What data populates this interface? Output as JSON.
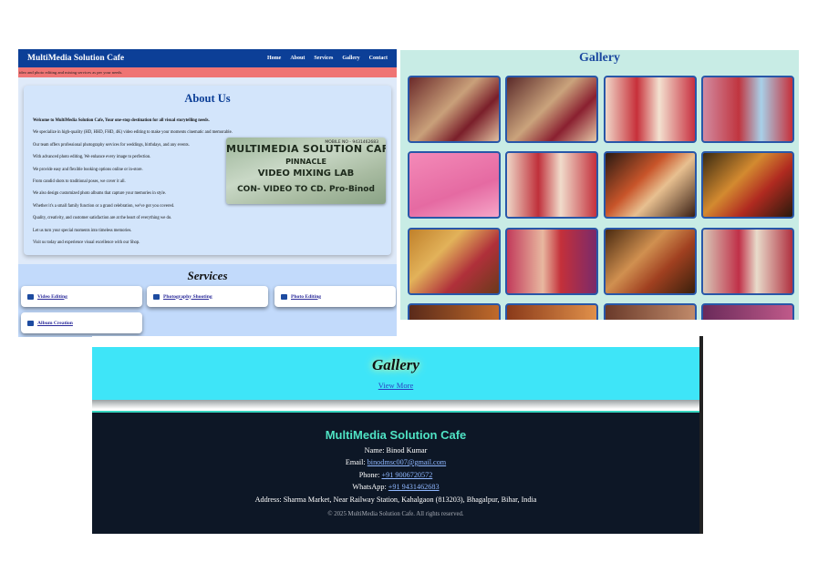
{
  "home": {
    "brand": "MultiMedia Solution Cafe",
    "nav": [
      "Home",
      "About",
      "Services",
      "Gallery",
      "Contact"
    ],
    "marquee": "ideo and photo editing and mixing services as per your needs.",
    "about": {
      "title": "About Us",
      "lines": [
        "Welcome to MultiMedia Solution Cafe, Your one-stop destination for all visual storytelling needs.",
        "We specialize in high-quality (HD, HHD, FHD, 4K) video editing to make your moments cinematic and memorable.",
        "Our team offers professional photography services for weddings, birthdays, and any events.",
        "With advanced photo editing, We enhance every image to perfection.",
        "We provide easy and flexible booking options online or in-store.",
        "From candid shots to traditional poses, we cover it all.",
        "We also design customized photo albums that capture your memories in style.",
        "Whether it's a small family function or a grand celebration, we've got you covered.",
        "Quality, creativity, and customer satisfaction are at the heart of everything we do.",
        "Let us turn your special moments into timeless memories.",
        "Visit us today and experience visual excellence with our Shop."
      ],
      "shop_sign": {
        "line1": "MULTIMEDIA SOLUTION CAFE",
        "line2": "PINNACLE",
        "line3": "VIDEO MIXING LAB",
        "line4": "CON- VIDEO TO CD. Pro-Binod",
        "mobile": "MOBILE NO - 9431462683"
      }
    },
    "services": {
      "title": "Services",
      "items": [
        {
          "label": "Video Editing",
          "icon": "video-camera-icon"
        },
        {
          "label": "Photography Shooting",
          "icon": "camera-icon"
        },
        {
          "label": "Photo Editing",
          "icon": "image-icon"
        },
        {
          "label": "Album Creation",
          "icon": "book-icon"
        }
      ]
    }
  },
  "gallery_page": {
    "title": "Gallery"
  },
  "gallery_section": {
    "title": "Gallery",
    "view_more": "View More"
  },
  "footer": {
    "title": "MultiMedia Solution Cafe",
    "name_line": "Name: Binod Kumar",
    "email_label": "Email: ",
    "email": "binodmsc007@gmail.com",
    "phone_label": "Phone: ",
    "phone": "+91 9006720572",
    "whatsapp_label": "WhatsApp: ",
    "whatsapp": "+91 9431462683",
    "address": "Address: Sharma Market, Near Railway Station, Kahalgaon (813203), Bhagalpur, Bihar, India",
    "copyright": "© 2025 MultiMedia Solution Cafe. All rights reserved."
  },
  "colors": {
    "navbar": "#0c3f97",
    "marquee": "#ef7474",
    "footer_bg": "#0d1726",
    "footer_title": "#4fe3c4",
    "gallery_band": "#3ee5f8"
  }
}
